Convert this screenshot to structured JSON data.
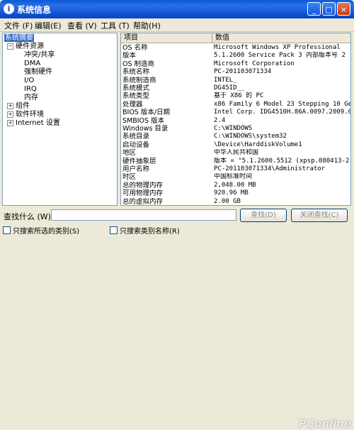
{
  "window": {
    "title": "系统信息",
    "icon": "info-icon",
    "minimize": "_",
    "maximize": "□",
    "close": "×"
  },
  "menu": [
    "文件 (F)",
    "编辑(E)",
    "查看 (V)",
    "工具 (T)",
    "帮助(H)"
  ],
  "tree": {
    "root": "系统摘要",
    "hw": "硬件资源",
    "hw_children": [
      "冲突/共享",
      "DMA",
      "强制硬件",
      "I/O",
      "IRQ",
      "内存"
    ],
    "components": "组件",
    "software": "软件环境",
    "internet": "Internet 设置"
  },
  "table": {
    "headers": {
      "item": "项目",
      "value": "数值"
    },
    "rows": [
      {
        "item": "OS 名称",
        "value": "Microsoft Windows XP Professional"
      },
      {
        "item": "版本",
        "value": "5.1.2600 Service Pack 3 内部版本号 2"
      },
      {
        "item": "OS 制造商",
        "value": "Microsoft Corporation"
      },
      {
        "item": "系统名称",
        "value": "PC-201103071334"
      },
      {
        "item": "系统制造商",
        "value": "INTEL_"
      },
      {
        "item": "系统模式",
        "value": "DG45ID__"
      },
      {
        "item": "系统类型",
        "value": "基于 X86 的 PC"
      },
      {
        "item": "处理器",
        "value": "x86 Family 6 Model 23 Stepping 10 Ge"
      },
      {
        "item": "BIOS 版本/日期",
        "value": "Intel Corp. IDG4510H.86A.0097.2009.0"
      },
      {
        "item": "SMBIOS 版本",
        "value": "2.4"
      },
      {
        "item": "Windows 目录",
        "value": "C:\\WINDOWS"
      },
      {
        "item": "系统目录",
        "value": "C:\\WINDOWS\\system32"
      },
      {
        "item": "启动设备",
        "value": "\\Device\\HarddiskVolume1"
      },
      {
        "item": "地区",
        "value": "中华人民共和国"
      },
      {
        "item": "硬件抽象层",
        "value": "版本 = \"5.1.2600.5512 (xpsp.080413-2"
      },
      {
        "item": "用户名称",
        "value": "PC-201103071334\\Administrator"
      },
      {
        "item": "时区",
        "value": "中国标准时间"
      },
      {
        "item": "总的物理内存",
        "value": "2,048.00 MB"
      },
      {
        "item": "可用物理内存",
        "value": "920.96 MB"
      },
      {
        "item": "总的虚拟内存",
        "value": "2.00 GB"
      }
    ]
  },
  "find": {
    "label": "查找什么 (W):",
    "input_value": "",
    "find_button": "查找(D)",
    "close_button": "关闭查找(C)",
    "option1": "只搜索所选的类别(S)",
    "option2": "只搜索类别名称(R)"
  },
  "watermark": "PConline"
}
